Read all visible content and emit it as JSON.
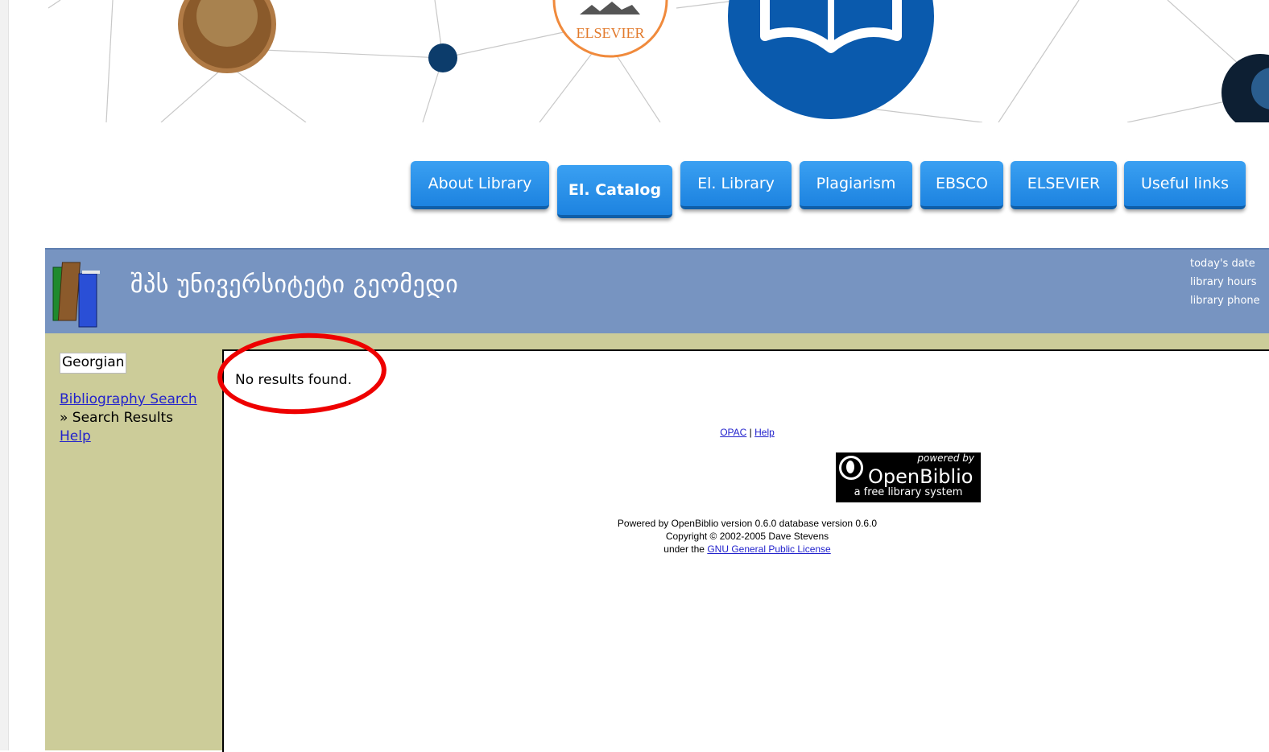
{
  "banner": {
    "elsevier_text": "ELSEVIER"
  },
  "nav": {
    "items": [
      {
        "label": "About Library"
      },
      {
        "label": "El. Catalog",
        "active": true
      },
      {
        "label": "El. Library"
      },
      {
        "label": "Plagiarism"
      },
      {
        "label": "EBSCO"
      },
      {
        "label": "ELSEVIER"
      },
      {
        "label": "Useful links"
      }
    ]
  },
  "header": {
    "title": "შპს უნივერსიტეტი გეომედი",
    "info": {
      "date_label": "today's date",
      "hours_label": "library hours",
      "phone_label": "library phone"
    }
  },
  "sidebar": {
    "language": "Georgian",
    "links": {
      "bibliography_search": "Bibliography Search",
      "search_results": "» Search Results",
      "help": "Help"
    }
  },
  "main": {
    "message": "No results found."
  },
  "footer": {
    "opac": "OPAC",
    "separator": "|",
    "help": "Help",
    "logo": {
      "powered_by": "powered by",
      "name": "OpenBiblio",
      "tagline": "a free library system"
    },
    "powered_line": "Powered by OpenBiblio version 0.6.0 database version 0.6.0",
    "copyright_line": "Copyright © 2002-2005 Dave Stevens",
    "license_prefix": "under the",
    "license_link": "GNU General Public License"
  },
  "colors": {
    "nav_button": "#2590e8",
    "header_bar": "#7794c1",
    "sidebar": "#cccc99",
    "highlight_circle": "#ee0000"
  }
}
